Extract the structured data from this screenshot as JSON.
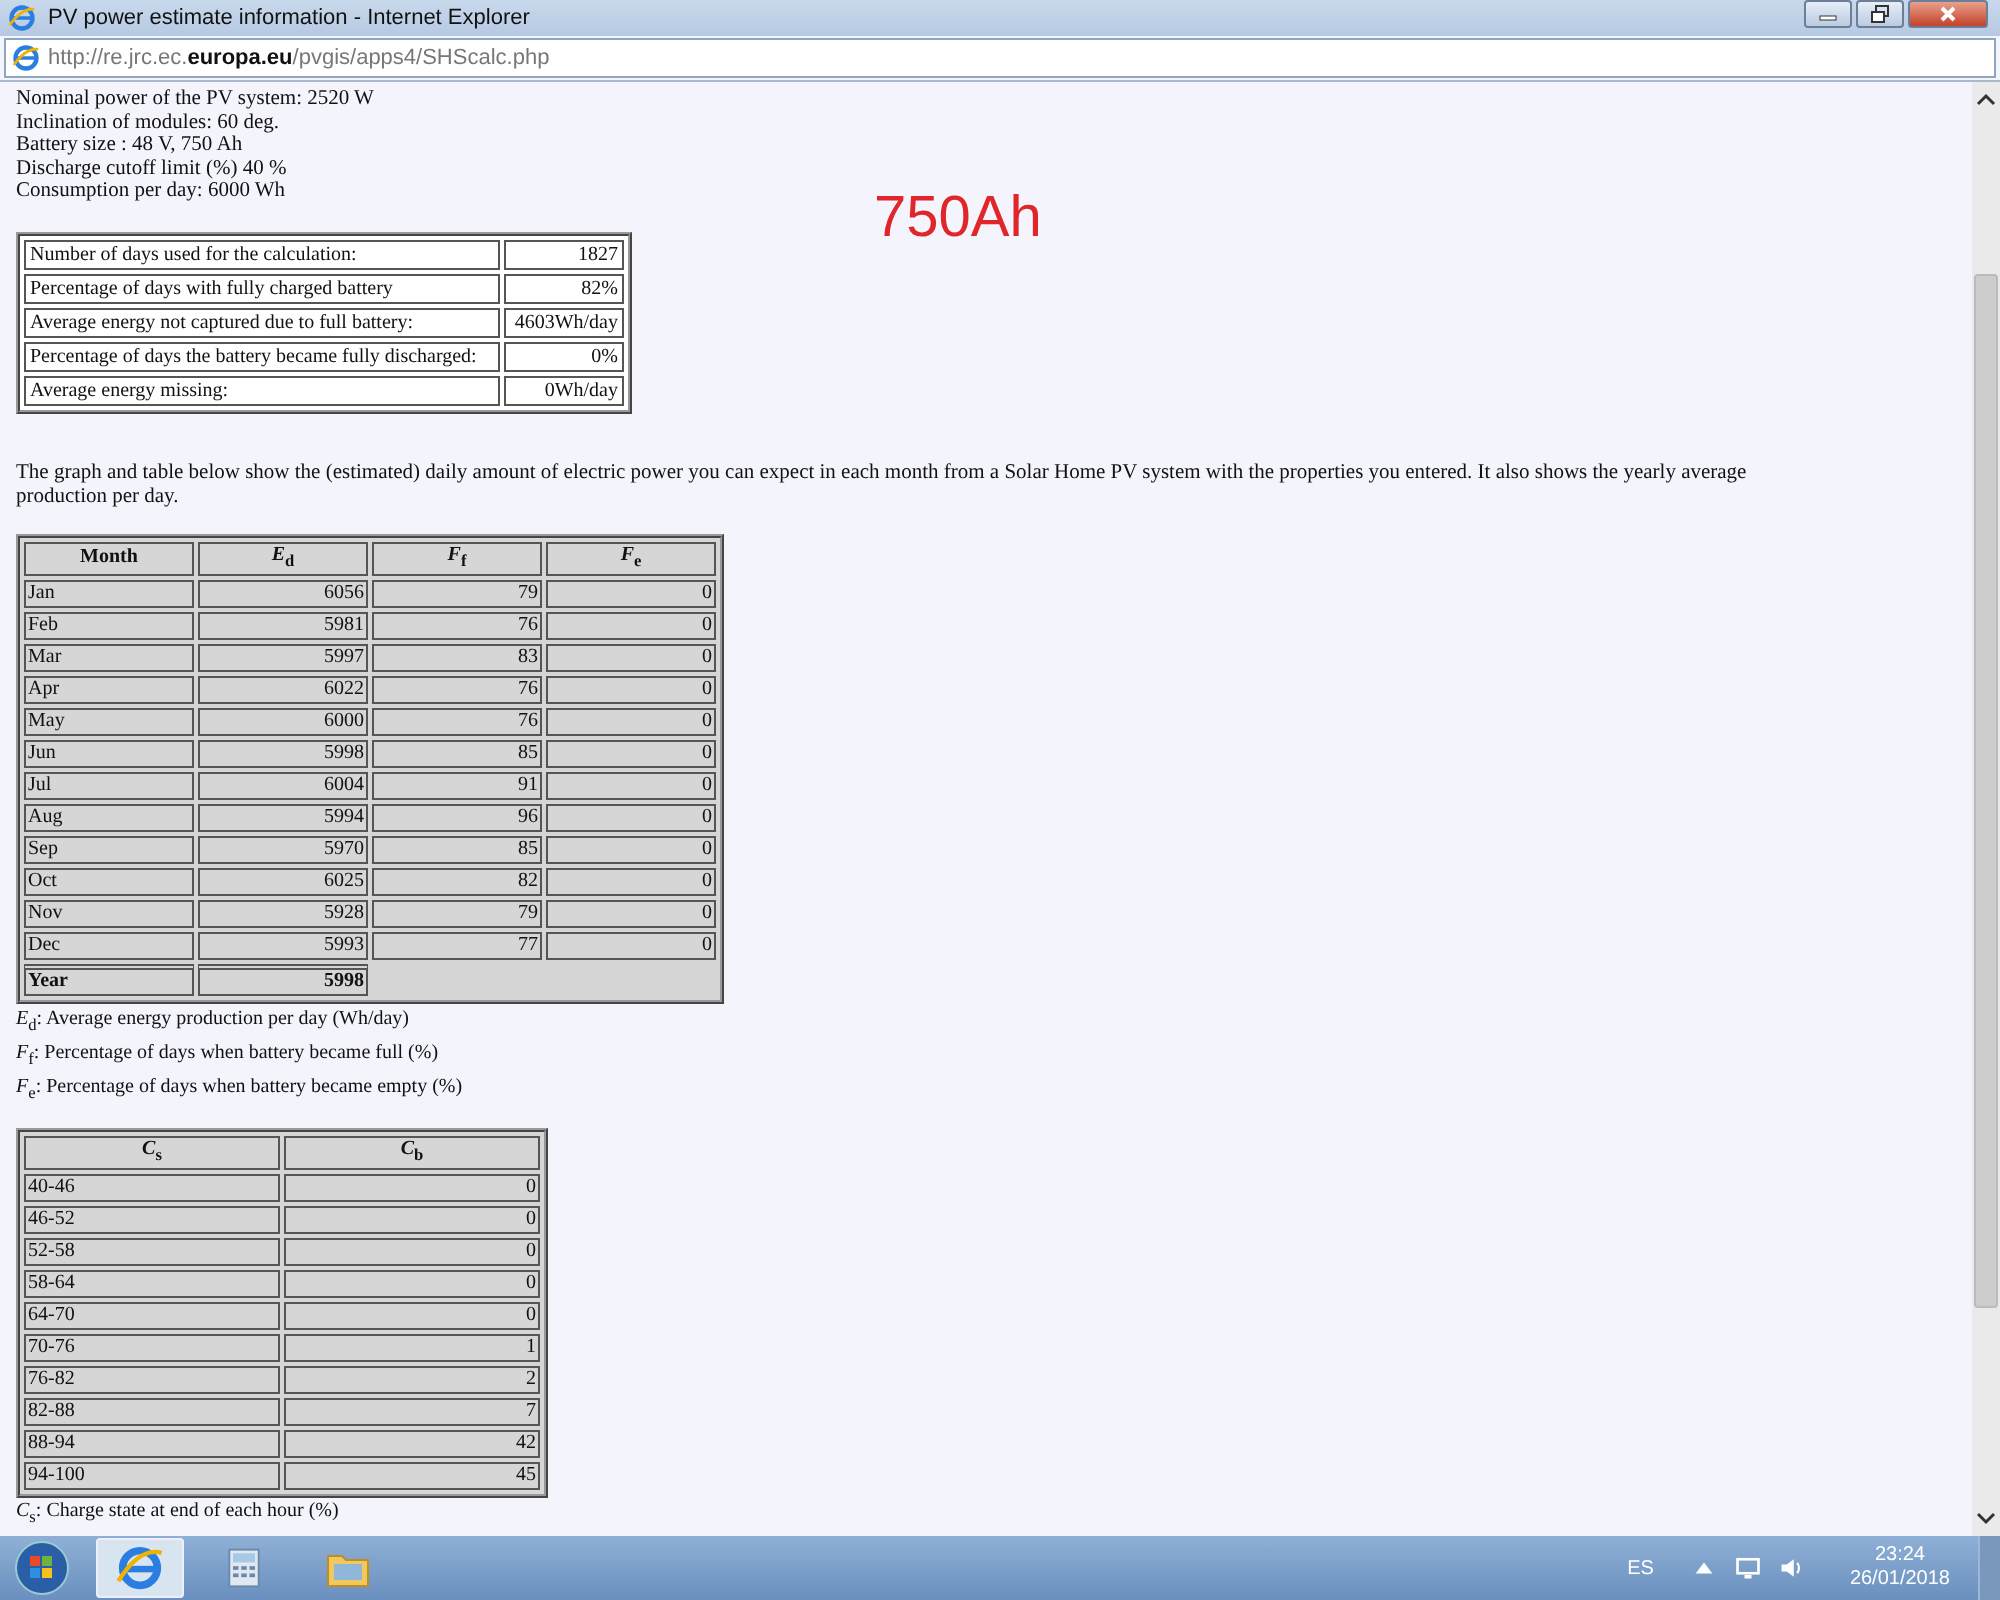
{
  "window": {
    "title": "PV power estimate information - Internet Explorer"
  },
  "address_bar": {
    "url": "http://re.jrc.ec.**europa.eu**/pvgis/apps4/SHScalc.php"
  },
  "summary": [
    "Nominal power of the PV system: 2520 W",
    "Inclination of modules: 60 deg.",
    "Battery size : 48 V, 750 Ah",
    "Discharge cutoff limit (%) 40 %",
    "Consumption per day: 6000 Wh"
  ],
  "overlay_note": "750Ah",
  "results": [
    {
      "label": "Number of days used for the calculation:",
      "value": "1827"
    },
    {
      "label": "Percentage of days with fully charged battery",
      "value": "82%"
    },
    {
      "label": "Average energy not captured due to full battery:",
      "value": "4603Wh/day"
    },
    {
      "label": "Percentage of days the battery became fully discharged:",
      "value": "0%"
    },
    {
      "label": "Average energy missing:",
      "value": "0Wh/day"
    }
  ],
  "intro": "The graph and table below show the (estimated) daily amount of electric power you can expect in each month from a Solar Home PV system with the properties you entered. It also shows the yearly average production per day.",
  "monthly_table": {
    "columns": [
      "Month",
      "*E*$_{d}$",
      "*F*$_{f}$",
      "*F*$_{e}$"
    ],
    "rows": [
      [
        "Jan",
        "6056",
        "79",
        "0"
      ],
      [
        "Feb",
        "5981",
        "76",
        "0"
      ],
      [
        "Mar",
        "5997",
        "83",
        "0"
      ],
      [
        "Apr",
        "6022",
        "76",
        "0"
      ],
      [
        "May",
        "6000",
        "76",
        "0"
      ],
      [
        "Jun",
        "5998",
        "85",
        "0"
      ],
      [
        "Jul",
        "6004",
        "91",
        "0"
      ],
      [
        "Aug",
        "5994",
        "96",
        "0"
      ],
      [
        "Sep",
        "5970",
        "85",
        "0"
      ],
      [
        "Oct",
        "6025",
        "82",
        "0"
      ],
      [
        "Nov",
        "5928",
        "79",
        "0"
      ],
      [
        "Dec",
        "5993",
        "77",
        "0"
      ]
    ],
    "year_row": [
      "Year",
      "5998"
    ]
  },
  "legend": [
    "*E*$_{d}$: Average energy production per day (Wh/day)",
    "*F*$_{f}$: Percentage of days when battery became full (%)",
    "*F*$_{e}$: Percentage of days when battery became empty (%)"
  ],
  "charge_table": {
    "columns": [
      "*C*$_{s}$",
      "*C*$_{b}$"
    ],
    "rows": [
      [
        "40-46",
        "0"
      ],
      [
        "46-52",
        "0"
      ],
      [
        "52-58",
        "0"
      ],
      [
        "58-64",
        "0"
      ],
      [
        "64-70",
        "0"
      ],
      [
        "70-76",
        "1"
      ],
      [
        "76-82",
        "2"
      ],
      [
        "82-88",
        "7"
      ],
      [
        "88-94",
        "42"
      ],
      [
        "94-100",
        "45"
      ]
    ]
  },
  "footnote": "*C*$_{s}$: Charge state at end of each hour (%)",
  "taskbar": {
    "language": "ES",
    "time": "23:24",
    "date": "26/01/2018"
  }
}
